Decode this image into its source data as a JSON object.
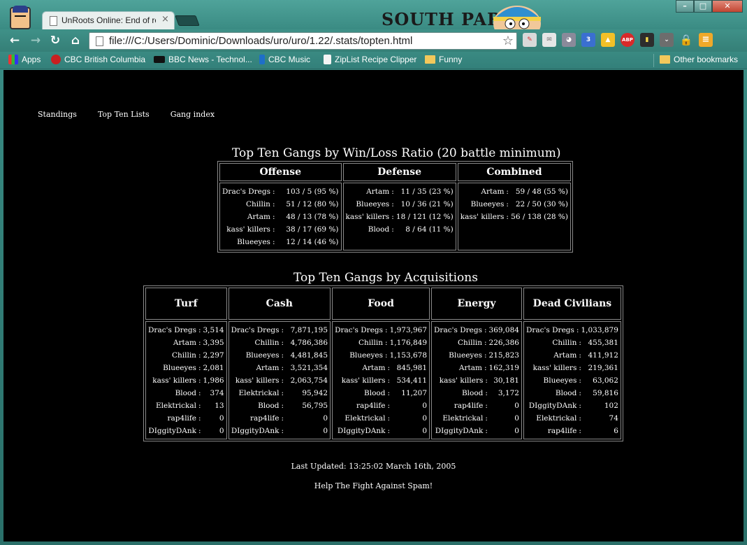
{
  "browser": {
    "tab_title": "UnRoots Online: End of ro",
    "theme_title": "SOUTH PARK",
    "url": "file:///C:/Users/Dominic/Downloads/uro/uro/1.22/.stats/topten.html",
    "extensions": [
      "mail-icon",
      "ghost-icon",
      "badge-3-icon",
      "drive-icon",
      "adblock-icon",
      "remote-icon",
      "pocket-icon",
      "lock-icon",
      "menu-icon"
    ],
    "extension_badge": "3",
    "abp_label": "ABP"
  },
  "bookmarks": {
    "apps": "Apps",
    "items": [
      "CBC British Columbia",
      "BBC News - Technol...",
      "CBC Music",
      "ZipList Recipe Clipper",
      "Funny"
    ],
    "other": "Other bookmarks"
  },
  "site_nav": [
    "Standings",
    "Top Ten Lists",
    "Gang index"
  ],
  "winloss": {
    "title": "Top Ten Gangs by Win/Loss Ratio (20 battle minimum)",
    "columns": [
      {
        "header": "Offense",
        "rows": [
          {
            "name": "Drac's Dregs",
            "value": "103 / 5 (95 %)"
          },
          {
            "name": "Chillin",
            "value": "51 / 12 (80 %)"
          },
          {
            "name": "Artam",
            "value": "48 / 13 (78 %)"
          },
          {
            "name": "kass' killers",
            "value": "38 / 17 (69 %)"
          },
          {
            "name": "Blueeyes",
            "value": "12 / 14 (46 %)"
          }
        ]
      },
      {
        "header": "Defense",
        "rows": [
          {
            "name": "Artam",
            "value": "11 / 35 (23 %)"
          },
          {
            "name": "Blueeyes",
            "value": "10 / 36 (21 %)"
          },
          {
            "name": "kass' killers",
            "value": "18 / 121 (12 %)"
          },
          {
            "name": "Blood",
            "value": "8 / 64 (11 %)"
          }
        ]
      },
      {
        "header": "Combined",
        "rows": [
          {
            "name": "Artam",
            "value": "59 / 48 (55 %)"
          },
          {
            "name": "Blueeyes",
            "value": "22 / 50 (30 %)"
          },
          {
            "name": "kass' killers",
            "value": "56 / 138 (28 %)"
          }
        ]
      }
    ]
  },
  "acquisitions": {
    "title": "Top Ten Gangs by Acquisitions",
    "columns": [
      {
        "header": "Turf",
        "rows": [
          {
            "name": "Drac's Dregs",
            "value": "3,514"
          },
          {
            "name": "Artam",
            "value": "3,395"
          },
          {
            "name": "Chillin",
            "value": "2,297"
          },
          {
            "name": "Blueeyes",
            "value": "2,081"
          },
          {
            "name": "kass' killers",
            "value": "1,986"
          },
          {
            "name": "Blood",
            "value": "374"
          },
          {
            "name": "Elektrickal",
            "value": "13"
          },
          {
            "name": "rap4life",
            "value": "0"
          },
          {
            "name": "DIggityDAnk",
            "value": "0"
          }
        ]
      },
      {
        "header": "Cash",
        "rows": [
          {
            "name": "Drac's Dregs",
            "value": "7,871,195"
          },
          {
            "name": "Chillin",
            "value": "4,786,386"
          },
          {
            "name": "Blueeyes",
            "value": "4,481,845"
          },
          {
            "name": "Artam",
            "value": "3,521,354"
          },
          {
            "name": "kass' killers",
            "value": "2,063,754"
          },
          {
            "name": "Elektrickal",
            "value": "95,942"
          },
          {
            "name": "Blood",
            "value": "56,795"
          },
          {
            "name": "rap4life",
            "value": "0"
          },
          {
            "name": "DIggityDAnk",
            "value": "0"
          }
        ]
      },
      {
        "header": "Food",
        "rows": [
          {
            "name": "Drac's Dregs",
            "value": "1,973,967"
          },
          {
            "name": "Chillin",
            "value": "1,176,849"
          },
          {
            "name": "Blueeyes",
            "value": "1,153,678"
          },
          {
            "name": "Artam",
            "value": "845,981"
          },
          {
            "name": "kass' killers",
            "value": "534,411"
          },
          {
            "name": "Blood",
            "value": "11,207"
          },
          {
            "name": "rap4life",
            "value": "0"
          },
          {
            "name": "Elektrickal",
            "value": "0"
          },
          {
            "name": "DIggityDAnk",
            "value": "0"
          }
        ]
      },
      {
        "header": "Energy",
        "rows": [
          {
            "name": "Drac's Dregs",
            "value": "369,084"
          },
          {
            "name": "Chillin",
            "value": "226,386"
          },
          {
            "name": "Blueeyes",
            "value": "215,823"
          },
          {
            "name": "Artam",
            "value": "162,319"
          },
          {
            "name": "kass' killers",
            "value": "30,181"
          },
          {
            "name": "Blood",
            "value": "3,172"
          },
          {
            "name": "rap4life",
            "value": "0"
          },
          {
            "name": "Elektrickal",
            "value": "0"
          },
          {
            "name": "DIggityDAnk",
            "value": "0"
          }
        ]
      },
      {
        "header": "Dead Civilians",
        "rows": [
          {
            "name": "Drac's Dregs",
            "value": "1,033,879"
          },
          {
            "name": "Chillin",
            "value": "455,381"
          },
          {
            "name": "Artam",
            "value": "411,912"
          },
          {
            "name": "kass' killers",
            "value": "219,361"
          },
          {
            "name": "Blueeyes",
            "value": "63,062"
          },
          {
            "name": "Blood",
            "value": "59,816"
          },
          {
            "name": "DIggityDAnk",
            "value": "102"
          },
          {
            "name": "Elektrickal",
            "value": "74"
          },
          {
            "name": "rap4life",
            "value": "6"
          }
        ]
      }
    ]
  },
  "footer": {
    "last_updated": "Last Updated: 13:25:02 March 16th, 2005",
    "spam": "Help The Fight Against Spam!"
  }
}
